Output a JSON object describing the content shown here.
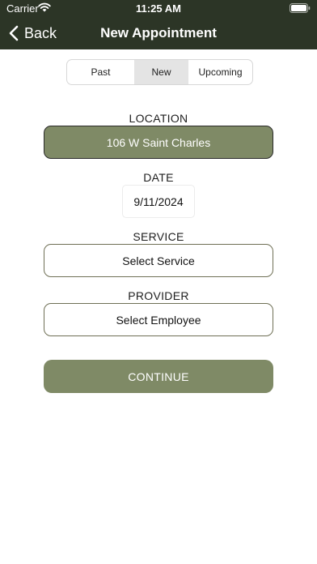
{
  "status_bar": {
    "carrier": "Carrier",
    "time": "11:25 AM"
  },
  "nav": {
    "back_label": "Back",
    "title": "New Appointment"
  },
  "segments": [
    "Past",
    "New",
    "Upcoming"
  ],
  "selected_segment": "New",
  "location": {
    "label": "LOCATION",
    "value": "106 W Saint Charles"
  },
  "date": {
    "label": "DATE",
    "value": "9/11/2024"
  },
  "service": {
    "label": "SERVICE",
    "value": "Select Service"
  },
  "provider": {
    "label": "PROVIDER",
    "value": "Select Employee"
  },
  "continue_label": "CONTINUE",
  "colors": {
    "header_bg": "#2c3526",
    "accent": "#7f8a66"
  }
}
